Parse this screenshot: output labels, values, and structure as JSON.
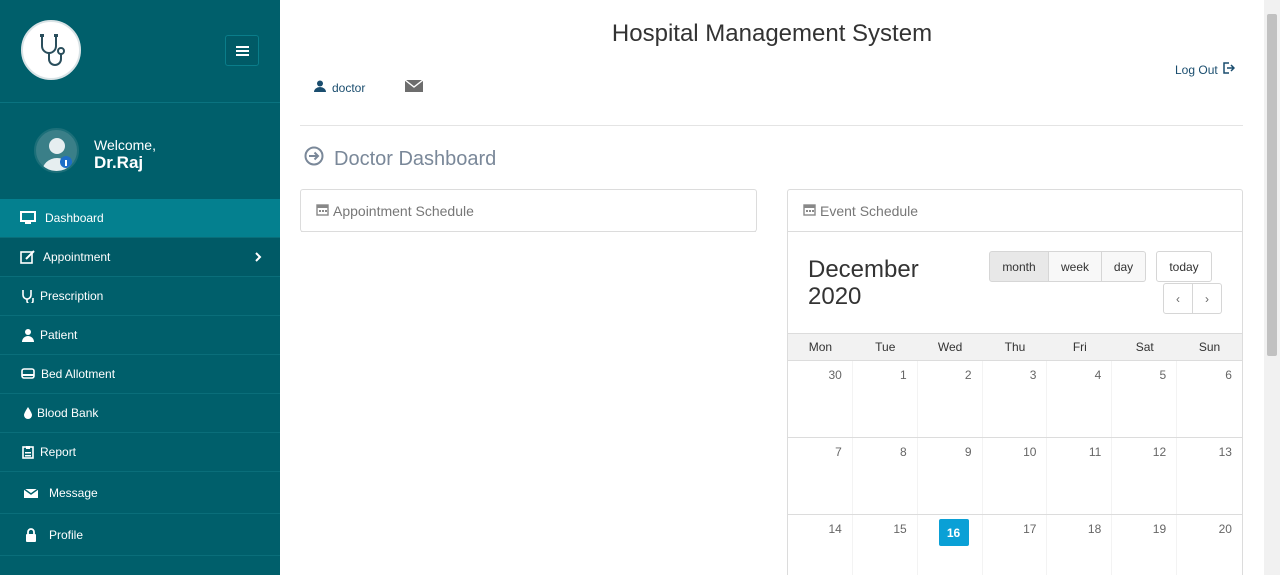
{
  "app": {
    "title": "Hospital Management System"
  },
  "sidebar": {
    "welcome_label": "Welcome,",
    "user_name": "Dr.Raj",
    "items": [
      {
        "label": "Dashboard",
        "icon": "monitor-icon",
        "active": true
      },
      {
        "label": "Appointment",
        "icon": "edit-icon",
        "has_children": true
      },
      {
        "label": "Prescription",
        "icon": "stethoscope-icon"
      },
      {
        "label": "Patient",
        "icon": "user-icon"
      },
      {
        "label": "Bed Allotment",
        "icon": "bed-icon"
      },
      {
        "label": "Blood Bank",
        "icon": "drop-icon"
      },
      {
        "label": "Report",
        "icon": "clipboard-icon"
      },
      {
        "label": "Message",
        "icon": "envelope-icon"
      },
      {
        "label": "Profile",
        "icon": "lock-icon"
      }
    ]
  },
  "header": {
    "user_label": "doctor",
    "logout_label": "Log Out"
  },
  "dashboard": {
    "title": "Doctor Dashboard",
    "appointment_panel_title": "Appointment Schedule",
    "event_panel_title": "Event Schedule"
  },
  "calendar": {
    "month": "December",
    "year": "2020",
    "views": [
      "month",
      "week",
      "day"
    ],
    "active_view": "month",
    "today_label": "today",
    "prev_label": "‹",
    "next_label": "›",
    "weekdays": [
      "Mon",
      "Tue",
      "Wed",
      "Thu",
      "Fri",
      "Sat",
      "Sun"
    ],
    "weeks": [
      [
        "30",
        "1",
        "2",
        "3",
        "4",
        "5",
        "6"
      ],
      [
        "7",
        "8",
        "9",
        "10",
        "11",
        "12",
        "13"
      ],
      [
        "14",
        "15",
        "16",
        "17",
        "18",
        "19",
        "20"
      ]
    ],
    "today_day": "16"
  },
  "colors": {
    "sidebar": "#005f6b",
    "sidebar_active": "#04808f",
    "today_highlight": "#0aa0d6"
  }
}
